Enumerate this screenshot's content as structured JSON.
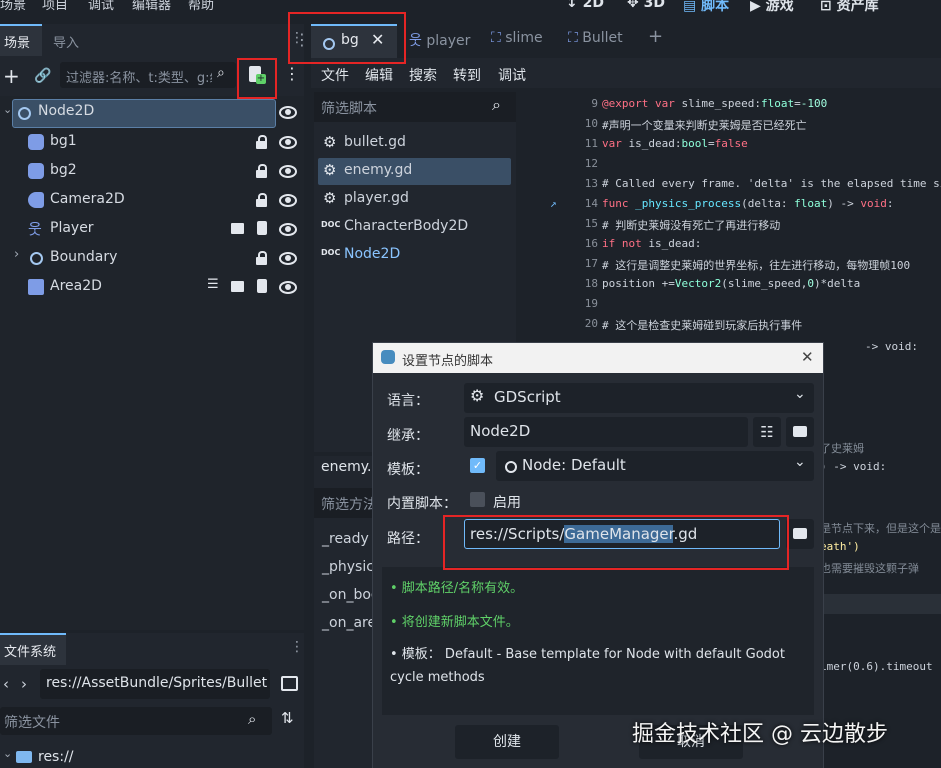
{
  "topbar": {
    "menus": [
      "场景",
      "项目",
      "调试",
      "编辑器",
      "帮助"
    ],
    "modes": [
      "2D",
      "3D",
      "脚本",
      "游戏",
      "资产库"
    ]
  },
  "scene_dock": {
    "tabs": [
      "场景",
      "导入"
    ],
    "filter_placeholder": "过滤器:名称、t:类型、g:组",
    "tree": [
      {
        "label": "Node2D"
      },
      {
        "label": "bg1"
      },
      {
        "label": "bg2"
      },
      {
        "label": "Camera2D"
      },
      {
        "label": "Player"
      },
      {
        "label": "Boundary"
      },
      {
        "label": "Area2D"
      }
    ]
  },
  "fs_dock": {
    "title": "文件系统",
    "path": "res://AssetBundle/Sprites/Bullet.",
    "filter_placeholder": "筛选文件",
    "root": "res://"
  },
  "editor": {
    "tabs": [
      "bg",
      "player",
      "slime",
      "Bullet"
    ],
    "menus": [
      "文件",
      "编辑",
      "搜索",
      "转到",
      "调试"
    ],
    "filter_scripts_placeholder": "筛选脚本",
    "scripts": [
      "bullet.gd",
      "enemy.gd",
      "player.gd",
      "CharacterBody2D",
      "Node2D"
    ],
    "current_script": "enemy.gd",
    "filter_methods_placeholder": "筛选方法",
    "methods": [
      "_ready",
      "_physics",
      "_on_boo",
      "_on_are"
    ]
  },
  "code_lines": [
    {
      "n": "9",
      "t": "@export var slime_speed:float=-100"
    },
    {
      "n": "10",
      "t": "#声明一个变量来判断史莱姆是否已经死亡"
    },
    {
      "n": "11",
      "t": "var is_dead:bool=false"
    },
    {
      "n": "12",
      "t": ""
    },
    {
      "n": "13",
      "t": "# Called every frame. 'delta' is the elapsed time since"
    },
    {
      "n": "14",
      "t": "func _physics_process(delta: float) -> void:"
    },
    {
      "n": "15",
      "t": "#   判断史莱姆没有死亡了再进行移动"
    },
    {
      "n": "16",
      "t": "    if not is_dead:"
    },
    {
      "n": "17",
      "t": "#       这行是调整史莱姆的世界坐标，往左进行移动，每物理帧100"
    },
    {
      "n": "18",
      "t": "        position +=Vector2(slime_speed,0)*delta"
    },
    {
      "n": "19",
      "t": ""
    },
    {
      "n": "20",
      "t": "#   这个是检查史莱姆碰到玩家后执行事件"
    }
  ],
  "code_right": {
    "r1": "-> void:",
    "r2": "了史莱姆",
    "r3": ") -> void:",
    "r4": "是节点下来，但是这个是",
    "r5": "eath')",
    "r6": "也需要摧毁这颗子弹",
    "r7": "imer(0.6).timeout"
  },
  "dialog": {
    "title": "设置节点的脚本",
    "language_label": "语言：",
    "language_value": "GDScript",
    "inherits_label": "继承：",
    "inherits_value": "Node2D",
    "template_label": "模板：",
    "template_value": "Node: Default",
    "builtin_label": "内置脚本：",
    "builtin_value": "启用",
    "path_label": "路径：",
    "path_prefix": "res://Scripts/",
    "path_selected": "GameManager",
    "path_suffix": ".gd",
    "messages": [
      "• 脚本路径/名称有效。",
      "• 将创建新脚本文件。",
      "• 模板：  Default - Base template for Node with default Godot cycle methods"
    ],
    "create_button": "创建",
    "cancel_button": "取消"
  },
  "watermark": "掘金技术社区 @ 云边散步"
}
